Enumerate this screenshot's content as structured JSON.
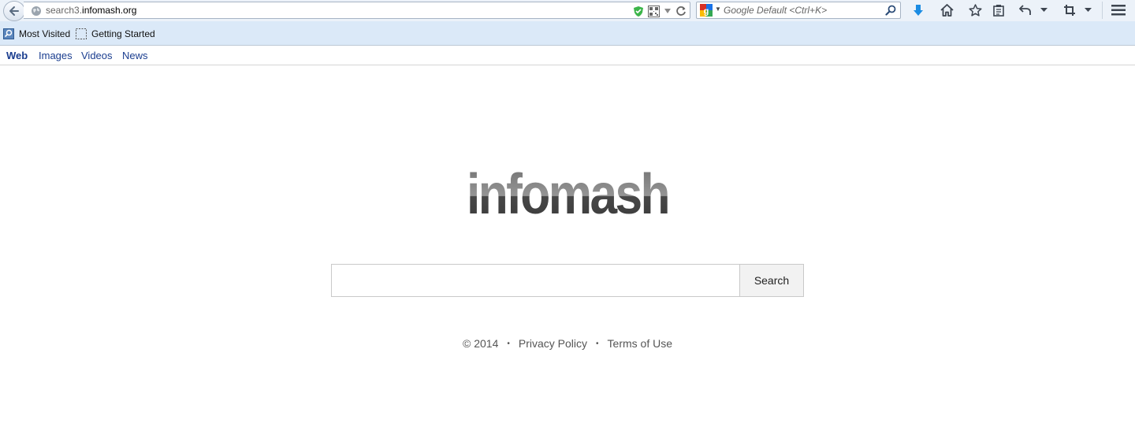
{
  "browser": {
    "url_prefix": "search3.",
    "url_domain": "infomash.org",
    "search_placeholder": "Google Default <Ctrl+K>"
  },
  "bookmarks": {
    "items": [
      {
        "label": "Most Visited"
      },
      {
        "label": "Getting Started"
      }
    ]
  },
  "search_nav": {
    "tabs": [
      {
        "label": "Web",
        "active": true
      },
      {
        "label": "Images"
      },
      {
        "label": "Videos"
      },
      {
        "label": "News"
      }
    ]
  },
  "main": {
    "logo_text": "infomash",
    "search_button": "Search"
  },
  "footer": {
    "copyright": "© 2014",
    "separator": "•",
    "privacy": "Privacy Policy",
    "terms": "Terms of Use"
  },
  "colors": {
    "nav_link": "#1a3d8f",
    "toolbar_bg": "#ecf2f9",
    "bookmarks_bg": "#dbe9f8",
    "logo_gray": "#4a4a4a"
  },
  "icons": [
    "back-arrow-icon",
    "globe-icon",
    "shield-check-icon",
    "qr-code-icon",
    "dropdown-arrow-icon",
    "reload-icon",
    "google-icon",
    "magnifier-icon",
    "download-icon",
    "home-icon",
    "star-icon",
    "clipboard-icon",
    "undo-icon",
    "crop-icon",
    "menu-icon"
  ]
}
